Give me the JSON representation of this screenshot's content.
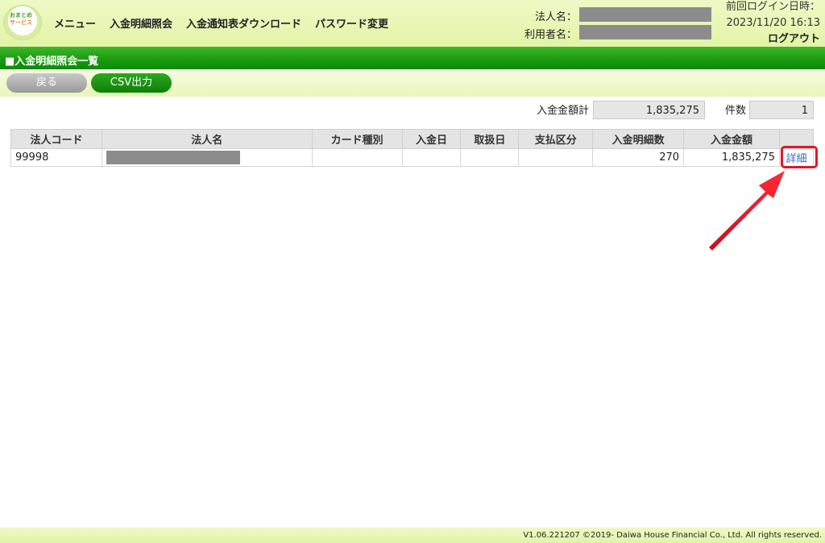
{
  "header": {
    "logo_line1": "おまとめ",
    "logo_line2": "サービス",
    "menu": [
      "メニュー",
      "入金明細照会",
      "入金通知表ダウンロード",
      "パスワード変更"
    ],
    "corp_name_label": "法人名：",
    "user_name_label": "利用者名：",
    "last_login_label": "前回ログイン日時：",
    "last_login_value": "2023/11/20 16:13",
    "logout_label": "ログアウト"
  },
  "page": {
    "title": "■入金明細照会一覧",
    "back_label": "戻る",
    "csv_label": "CSV出力"
  },
  "summary": {
    "total_label": "入金金額計",
    "total_value": "1,835,275",
    "count_label": "件数",
    "count_value": "1"
  },
  "table": {
    "headers": [
      "法人コード",
      "法人名",
      "カード種別",
      "入金日",
      "取扱日",
      "支払区分",
      "入金明細数",
      "入金金額",
      ""
    ],
    "rows": [
      {
        "code": "99998",
        "card_type": "",
        "deposit_date": "",
        "handling_date": "",
        "payment_type": "",
        "detail_count": "270",
        "amount": "1,835,275",
        "detail_link": "詳細"
      }
    ]
  },
  "footer": {
    "text": "V1.06.221207 ©2019- Daiwa House Financial Co., Ltd. All rights reserved."
  },
  "colors": {
    "accent_green": "#179b0f",
    "highlight_red": "#e0182a",
    "link_blue": "#2a6fd6"
  }
}
